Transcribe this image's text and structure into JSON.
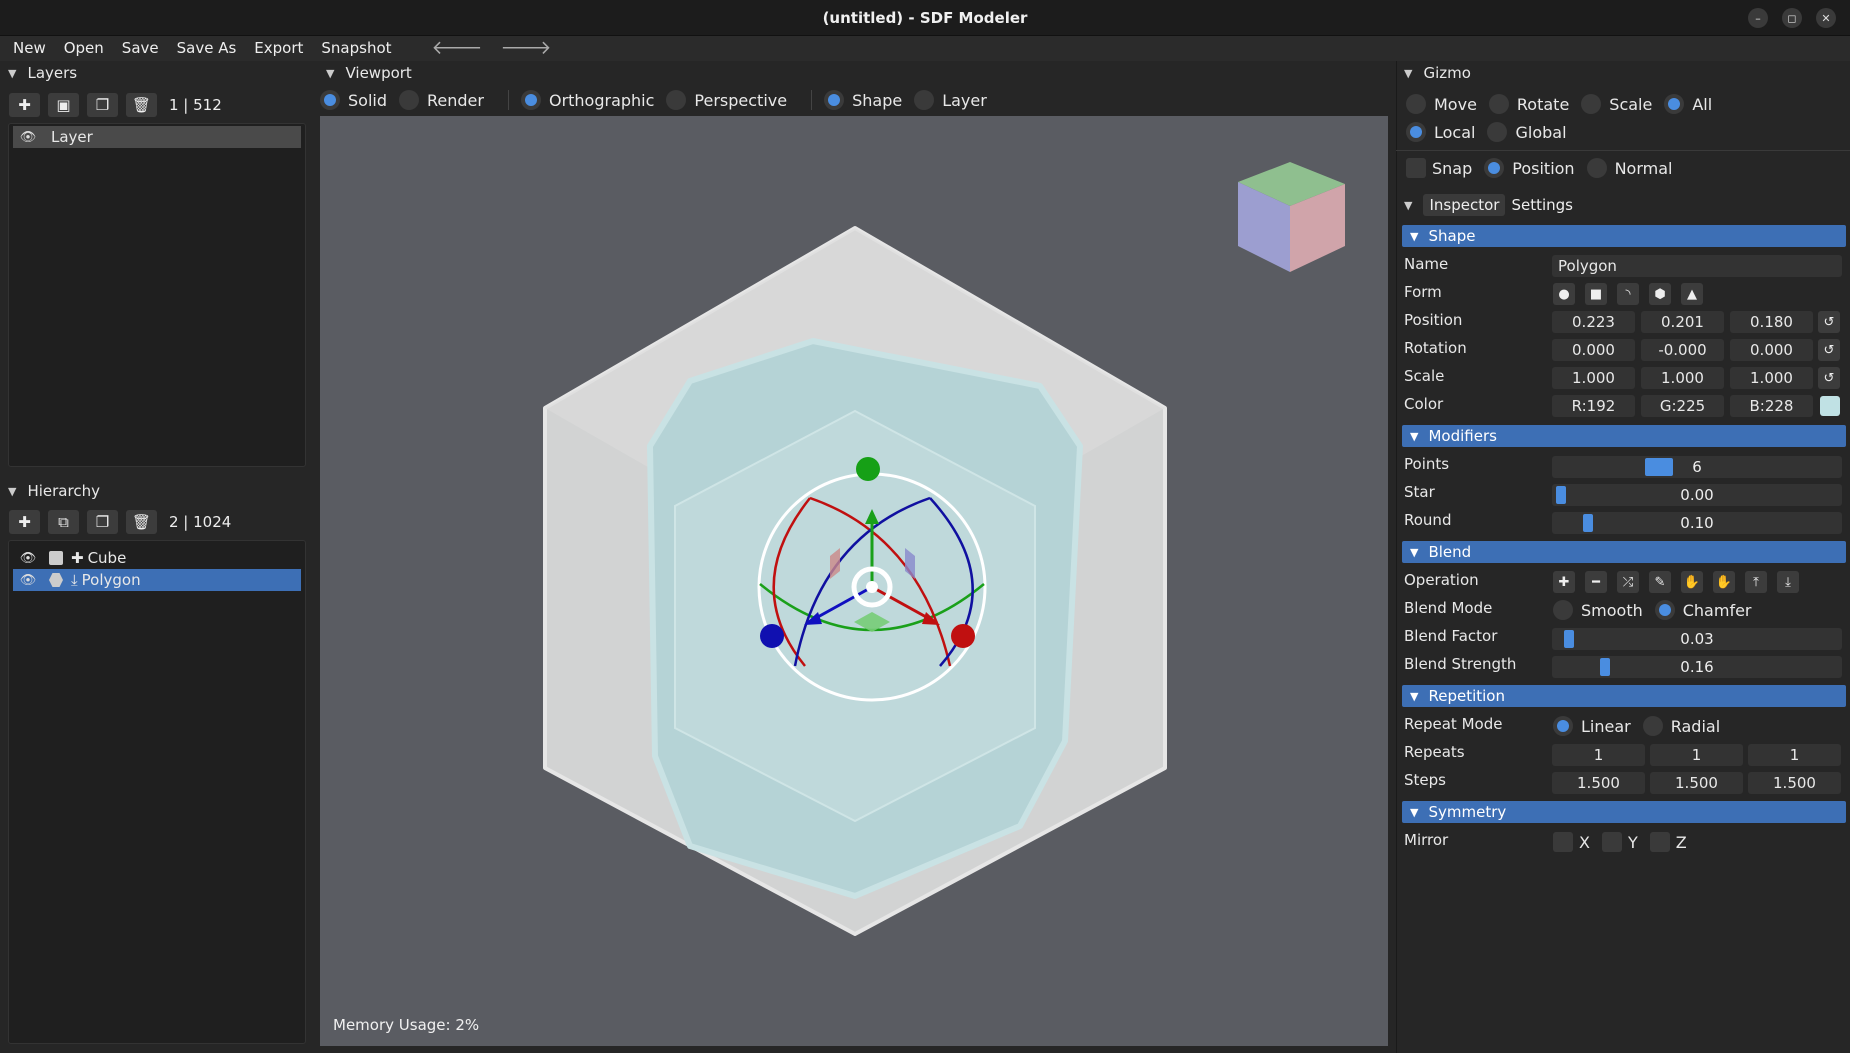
{
  "window": {
    "title": "(untitled) - SDF Modeler",
    "min": "–",
    "max": "◻",
    "close": "✕"
  },
  "menu": {
    "new": "New",
    "open": "Open",
    "save": "Save",
    "save_as": "Save As",
    "export": "Export",
    "snapshot": "Snapshot",
    "back": "🡐",
    "forward": "🡒"
  },
  "layers": {
    "title": "Layers",
    "count": "1 | 512",
    "items": [
      {
        "label": "Layer"
      }
    ]
  },
  "hierarchy": {
    "title": "Hierarchy",
    "count": "2 | 1024",
    "items": [
      {
        "label": "Cube"
      },
      {
        "label": "Polygon"
      }
    ]
  },
  "viewport": {
    "title": "Viewport",
    "modes": {
      "solid": "Solid",
      "render": "Render",
      "ortho": "Orthographic",
      "persp": "Perspective",
      "shape": "Shape",
      "layer": "Layer"
    },
    "memory": "Memory Usage: 2%"
  },
  "gizmo": {
    "title": "Gizmo",
    "move": "Move",
    "rotate": "Rotate",
    "scale": "Scale",
    "all": "All",
    "local": "Local",
    "global": "Global",
    "snap": "Snap",
    "position": "Position",
    "normal": "Normal"
  },
  "inspector": {
    "tab_inspector": "Inspector",
    "tab_settings": "Settings",
    "shape": {
      "title": "Shape",
      "name_label": "Name",
      "name": "Polygon",
      "form_label": "Form",
      "position_label": "Position",
      "position": [
        "0.223",
        "0.201",
        "0.180"
      ],
      "rotation_label": "Rotation",
      "rotation": [
        "0.000",
        "-0.000",
        "0.000"
      ],
      "scale_label": "Scale",
      "scale": [
        "1.000",
        "1.000",
        "1.000"
      ],
      "color_label": "Color",
      "color": [
        "R:192",
        "G:225",
        "B:228"
      ],
      "swatch": "#c0e1e4"
    },
    "modifiers": {
      "title": "Modifiers",
      "points_label": "Points",
      "points": "6",
      "points_frac": 0.35,
      "star_label": "Star",
      "star": "0.00",
      "star_frac": 0.0,
      "round_label": "Round",
      "round": "0.10",
      "round_frac": 0.1
    },
    "blend": {
      "title": "Blend",
      "operation_label": "Operation",
      "mode_label": "Blend Mode",
      "smooth": "Smooth",
      "chamfer": "Chamfer",
      "factor_label": "Blend Factor",
      "factor": "0.03",
      "factor_frac": 0.03,
      "strength_label": "Blend Strength",
      "strength": "0.16",
      "strength_frac": 0.16
    },
    "repetition": {
      "title": "Repetition",
      "mode_label": "Repeat Mode",
      "linear": "Linear",
      "radial": "Radial",
      "repeats_label": "Repeats",
      "repeats": [
        "1",
        "1",
        "1"
      ],
      "steps_label": "Steps",
      "steps": [
        "1.500",
        "1.500",
        "1.500"
      ]
    },
    "symmetry": {
      "title": "Symmetry",
      "mirror_label": "Mirror",
      "x": "X",
      "y": "Y",
      "z": "Z"
    }
  }
}
